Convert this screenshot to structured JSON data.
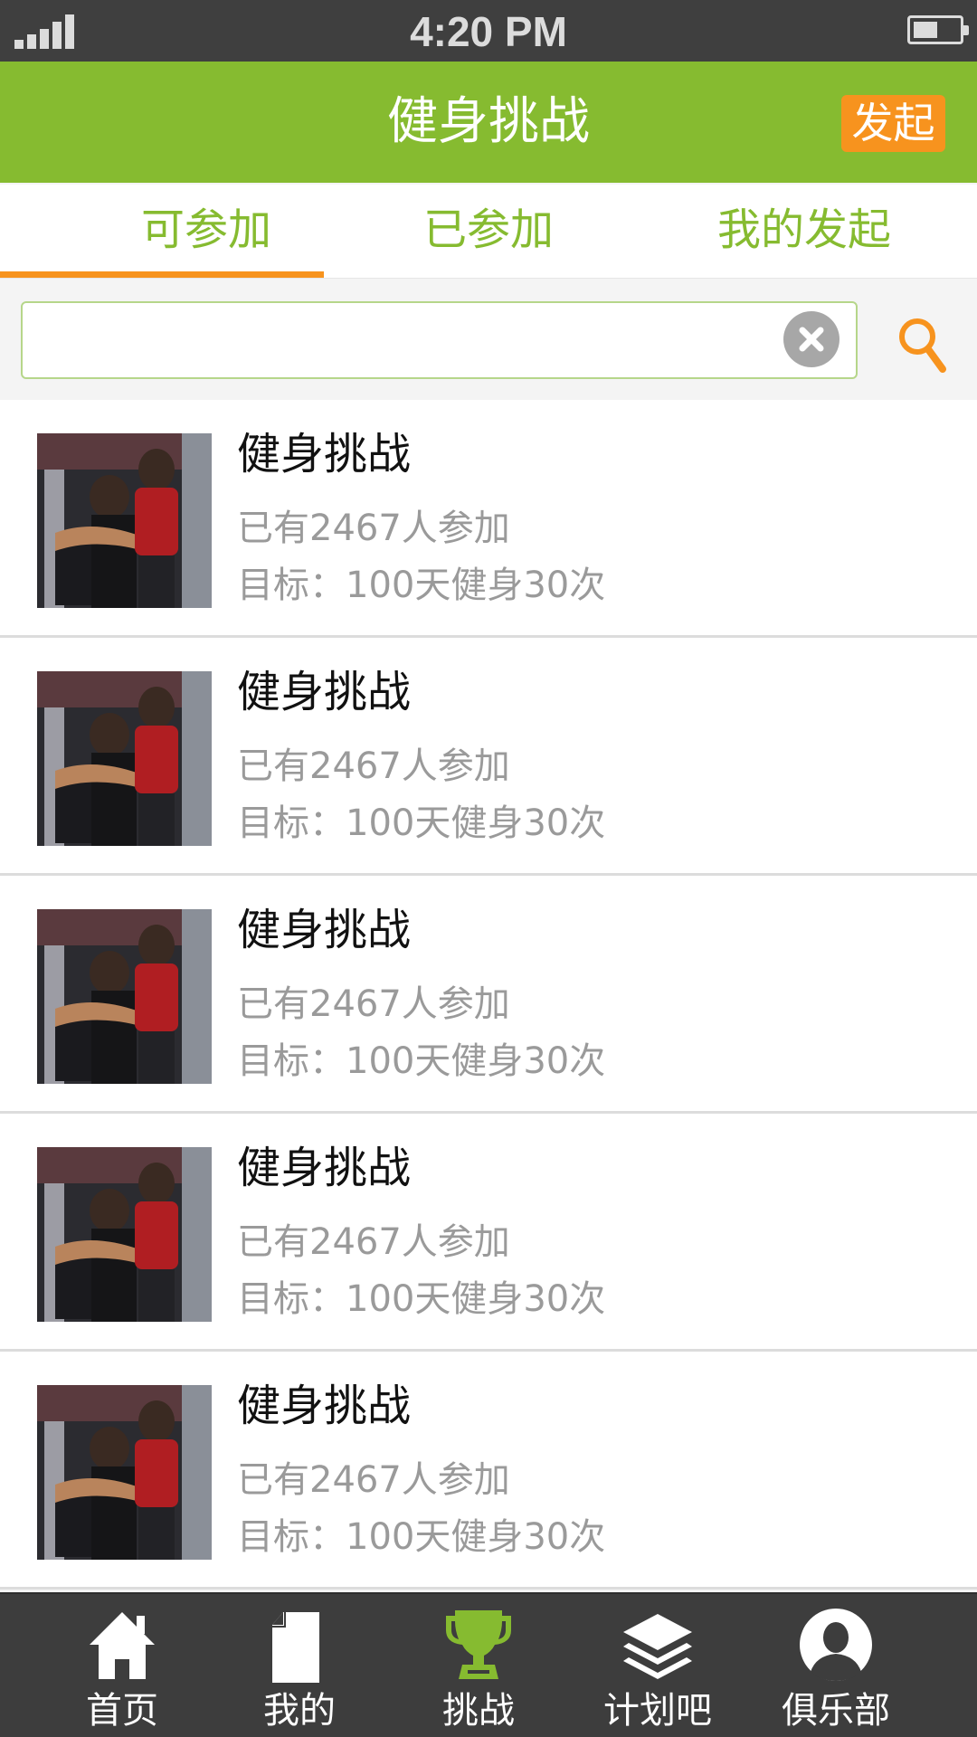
{
  "status_bar": {
    "time": "4:20 PM"
  },
  "header": {
    "title": "健身挑战",
    "launch_label": "发起"
  },
  "tabs": [
    {
      "label": "可参加",
      "active": true
    },
    {
      "label": "已参加",
      "active": false
    },
    {
      "label": "我的发起",
      "active": false
    }
  ],
  "search": {
    "value": ""
  },
  "challenges": [
    {
      "title": "健身挑战",
      "participants": "已有2467人参加",
      "goal": "目标：100天健身30次"
    },
    {
      "title": "健身挑战",
      "participants": "已有2467人参加",
      "goal": "目标：100天健身30次"
    },
    {
      "title": "健身挑战",
      "participants": "已有2467人参加",
      "goal": "目标：100天健身30次"
    },
    {
      "title": "健身挑战",
      "participants": "已有2467人参加",
      "goal": "目标：100天健身30次"
    },
    {
      "title": "健身挑战",
      "participants": "已有2467人参加",
      "goal": "目标：100天健身30次"
    }
  ],
  "bottom_nav": [
    {
      "label": "首页",
      "icon": "home-icon"
    },
    {
      "label": "我的",
      "icon": "document-icon"
    },
    {
      "label": "挑战",
      "icon": "trophy-icon",
      "active": true
    },
    {
      "label": "计划吧",
      "icon": "layers-icon"
    },
    {
      "label": "俱乐部",
      "icon": "user-icon"
    }
  ],
  "colors": {
    "brand_green": "#86bb30",
    "accent_orange": "#f7931e",
    "status_bar": "#3f3f3f",
    "nav_bar": "#3d3d3d"
  }
}
